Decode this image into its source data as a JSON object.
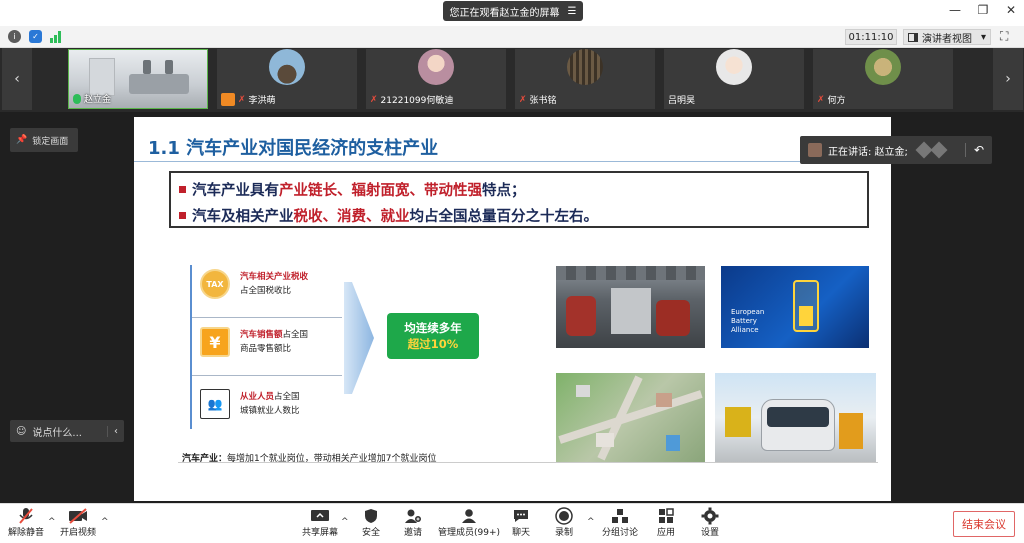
{
  "window": {
    "share_banner": "您正在观看赵立金的屏幕",
    "menu_glyph": "☰",
    "minimize": "—",
    "restore": "❐",
    "close": "✕"
  },
  "toolbar": {
    "timer": "01:11:10",
    "view_mode": "演讲者视图",
    "view_caret": "▾",
    "fullscreen": "⛶"
  },
  "strip": {
    "prev": "‹",
    "next": "›",
    "participants": [
      {
        "name": "赵立金",
        "status": "speaking"
      },
      {
        "name": "李洪萌",
        "status": "muted"
      },
      {
        "name": "21221099何敏迪",
        "status": "muted"
      },
      {
        "name": "张书铭",
        "status": "muted"
      },
      {
        "name": "吕明昊",
        "status": "none"
      },
      {
        "name": "何方",
        "status": "muted"
      }
    ]
  },
  "left_panel": {
    "lock_label": "锁定画面",
    "chat_placeholder": "说点什么...",
    "chat_arrow": "‹"
  },
  "speaking": {
    "label": "正在讲话: 赵立金;",
    "back": "↶"
  },
  "slide": {
    "title": "1.1 汽车产业对国民经济的支柱产业",
    "line1": {
      "a": "汽车产业具有",
      "b": "产业链长、辐射面宽、带动性强",
      "c": "特点；"
    },
    "line2": {
      "a": "汽车及相关产业",
      "b": "税收、消费、就业",
      "c": "均占全国总量百分之十左右。"
    },
    "stats": [
      {
        "icon": "TAX",
        "red": "汽车相关产业税收",
        "rest": "",
        "line2": "占全国税收比"
      },
      {
        "icon": "¥",
        "red": "汽车销售额",
        "rest": "占全国",
        "line2": "商品零售额比"
      },
      {
        "icon": "👥",
        "red": "从业人员",
        "rest": "占全国",
        "line2": "城镇就业人数比"
      }
    ],
    "green": {
      "line1": "均连续多年",
      "line2": "超过10%"
    },
    "note_bold": "汽车产业：",
    "note_rest": "每增加1个就业岗位，带动相关产业增加7个就业岗位",
    "battery_text": [
      "European",
      "Battery",
      "Alliance"
    ]
  },
  "bottom": {
    "items": [
      {
        "label": "解除静音"
      },
      {
        "label": "开启视频"
      },
      {
        "label": "共享屏幕"
      },
      {
        "label": "安全"
      },
      {
        "label": "邀请"
      },
      {
        "label": "管理成员(99+)"
      },
      {
        "label": "聊天"
      },
      {
        "label": "录制"
      },
      {
        "label": "分组讨论"
      },
      {
        "label": "应用"
      },
      {
        "label": "设置"
      }
    ],
    "caret": "^",
    "end_label": "结束会议"
  },
  "colors": {
    "accent_green": "#1ea84a",
    "title_blue": "#1e5fa0",
    "emphasis_red": "#c0202b",
    "end_red": "#d9352b"
  }
}
